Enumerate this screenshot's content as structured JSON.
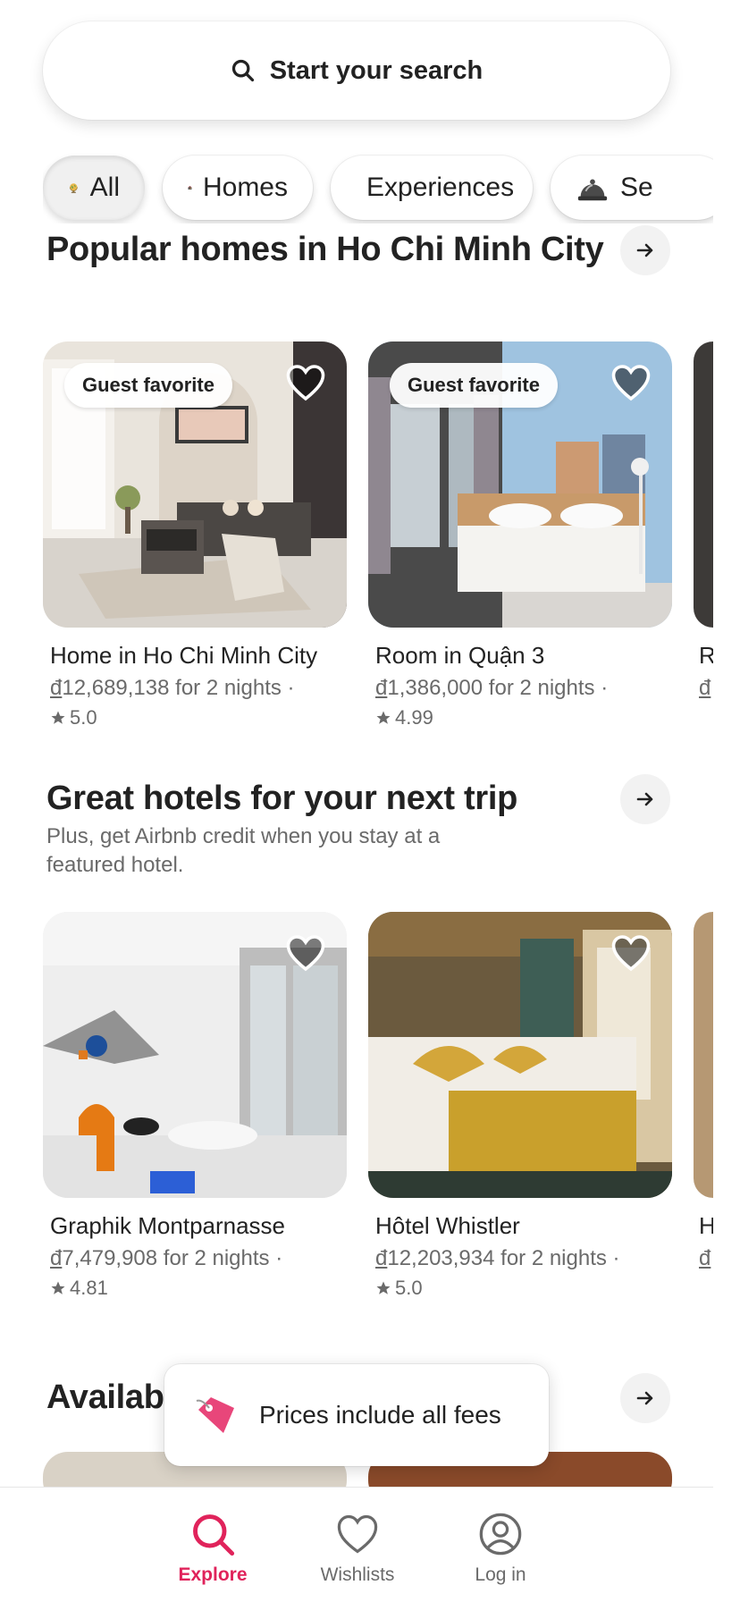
{
  "search": {
    "label": "Start your search"
  },
  "categories": [
    {
      "label": "All",
      "icon": "globe-icon",
      "selected": true
    },
    {
      "label": "Homes",
      "icon": "house-icon",
      "selected": false
    },
    {
      "label": "Experiences",
      "icon": "hot-air-balloon-icon",
      "selected": false
    },
    {
      "label": "Se",
      "icon": "service-bell-icon",
      "selected": false
    }
  ],
  "section1": {
    "title": "Popular homes in Ho Chi Minh City",
    "cards": [
      {
        "badge": "Guest favorite",
        "title": "Home in Ho Chi Minh City",
        "currency": "đ",
        "price": "12,689,138 for 2 nights",
        "rating": "5.0"
      },
      {
        "badge": "Guest favorite",
        "title": "Room in Quận 3",
        "currency": "đ",
        "price": "1,386,000 for 2 nights",
        "rating": "4.99"
      },
      {
        "title_partial": "R",
        "currency": "đ"
      }
    ]
  },
  "section2": {
    "title": "Great hotels for your next trip",
    "subtitle": "Plus, get Airbnb credit when you stay at a featured hotel.",
    "cards": [
      {
        "title": "Graphik Montparnasse",
        "currency": "đ",
        "price": "7,479,908 for 2 nights",
        "rating": "4.81"
      },
      {
        "title": "Hôtel Whistler",
        "currency": "đ",
        "price": "12,203,934 for 2 nights",
        "rating": "5.0"
      },
      {
        "title_partial": "H",
        "currency": "đ"
      }
    ]
  },
  "section3": {
    "title": "Available"
  },
  "fees_toast": {
    "text": "Prices include all fees",
    "icon": "price-tag-icon"
  },
  "nav": [
    {
      "label": "Explore",
      "icon": "search-icon",
      "active": true
    },
    {
      "label": "Wishlists",
      "icon": "heart-icon",
      "active": false
    },
    {
      "label": "Log in",
      "icon": "user-circle-icon",
      "active": false
    }
  ],
  "colors": {
    "brand": "#e0235b",
    "text": "#222222",
    "muted": "#6a6a6a"
  }
}
